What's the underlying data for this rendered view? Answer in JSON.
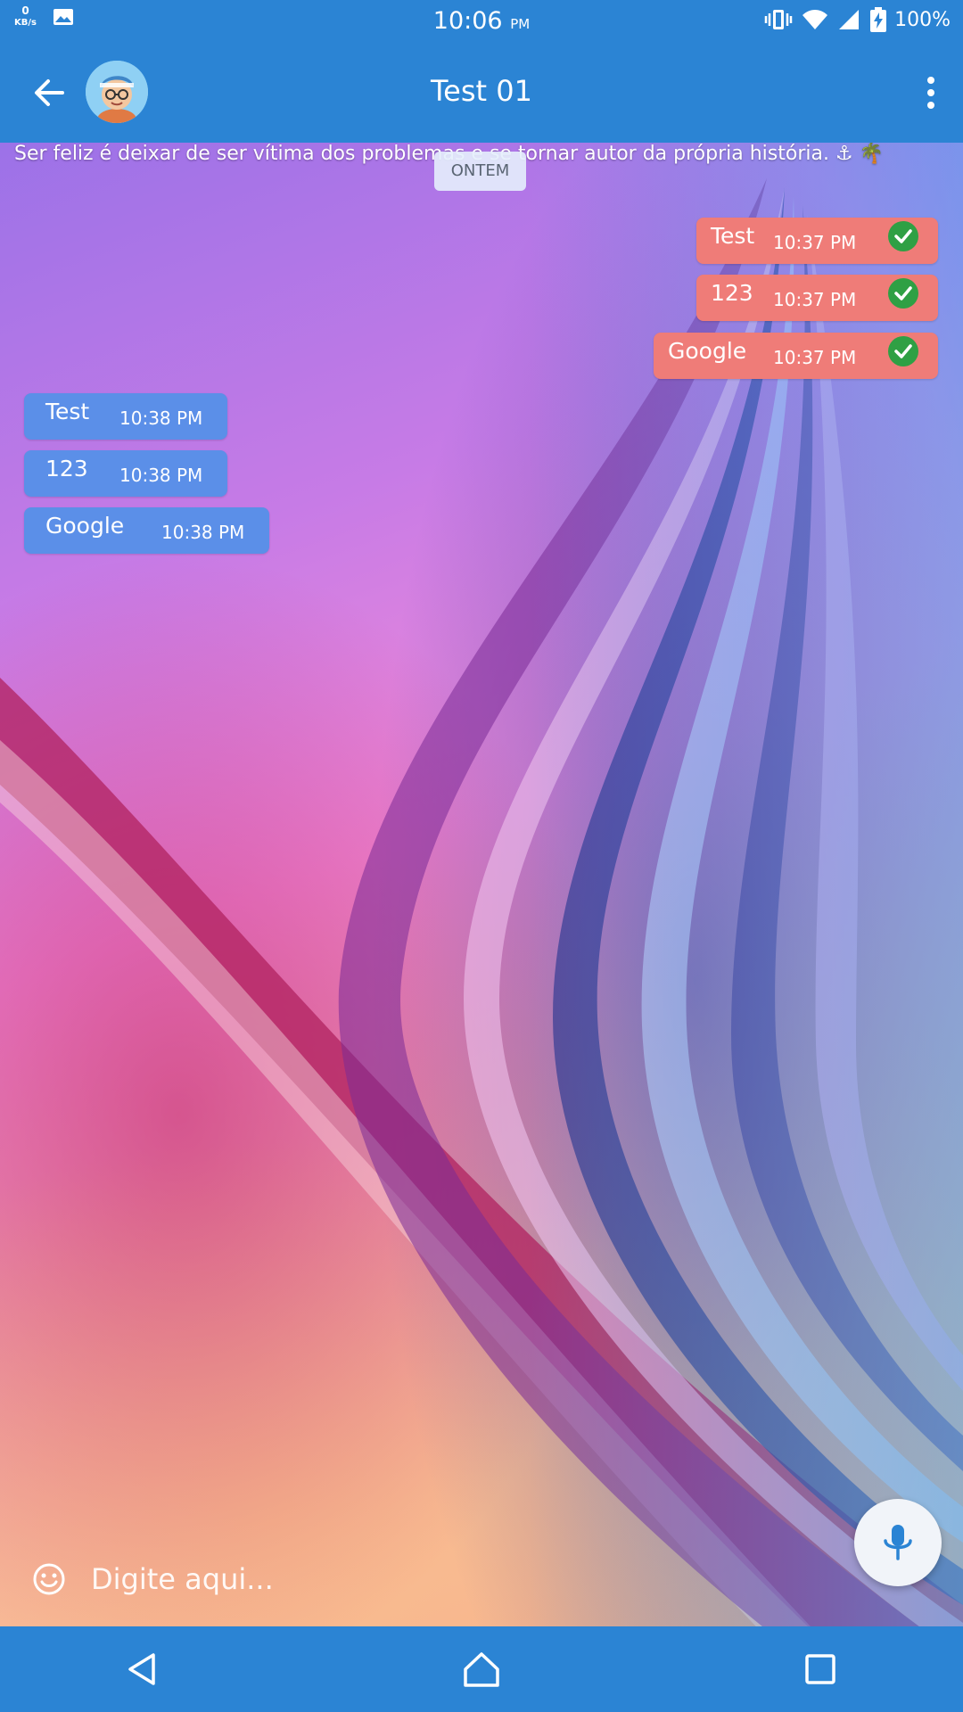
{
  "status_bar": {
    "network_speed_value": "0",
    "network_speed_unit": "KB/s",
    "time": "10:06",
    "time_suffix": "PM",
    "battery": "100%",
    "icons": [
      "image-icon",
      "vibrate-icon",
      "wifi-icon",
      "signal-icon",
      "battery-charging-icon"
    ]
  },
  "header": {
    "title": "Test 01",
    "back_icon": "arrow-back-icon",
    "menu_icon": "more-vert-icon",
    "avatar": "avatar"
  },
  "status_message": "Ser feliz é deixar de ser vítima dos problemas e se tornar autor da própria história. ⚓ 🌴",
  "date_chip": "ONTEM",
  "messages": {
    "sent": [
      {
        "text": "Test",
        "time": "10:37 PM",
        "read_icon": "check-circle-icon"
      },
      {
        "text": "123",
        "time": "10:37 PM",
        "read_icon": "check-circle-icon"
      },
      {
        "text": "Google",
        "time": "10:37 PM",
        "read_icon": "check-circle-icon"
      }
    ],
    "received": [
      {
        "text": "Test",
        "time": "10:38 PM"
      },
      {
        "text": "123",
        "time": "10:38 PM"
      },
      {
        "text": "Google",
        "time": "10:38 PM"
      }
    ]
  },
  "input": {
    "placeholder": "Digite aqui...",
    "value": "",
    "emoji_icon": "emoji-icon",
    "mic_icon": "mic-icon"
  },
  "nav_bar": {
    "icons": [
      "nav-back-icon",
      "nav-home-icon",
      "nav-recents-icon"
    ]
  },
  "colors": {
    "primary": "#2b84d4",
    "sent_bubble": "#ef7c78",
    "received_bubble": "#5b8fe8",
    "read_check": "#2fa044"
  }
}
